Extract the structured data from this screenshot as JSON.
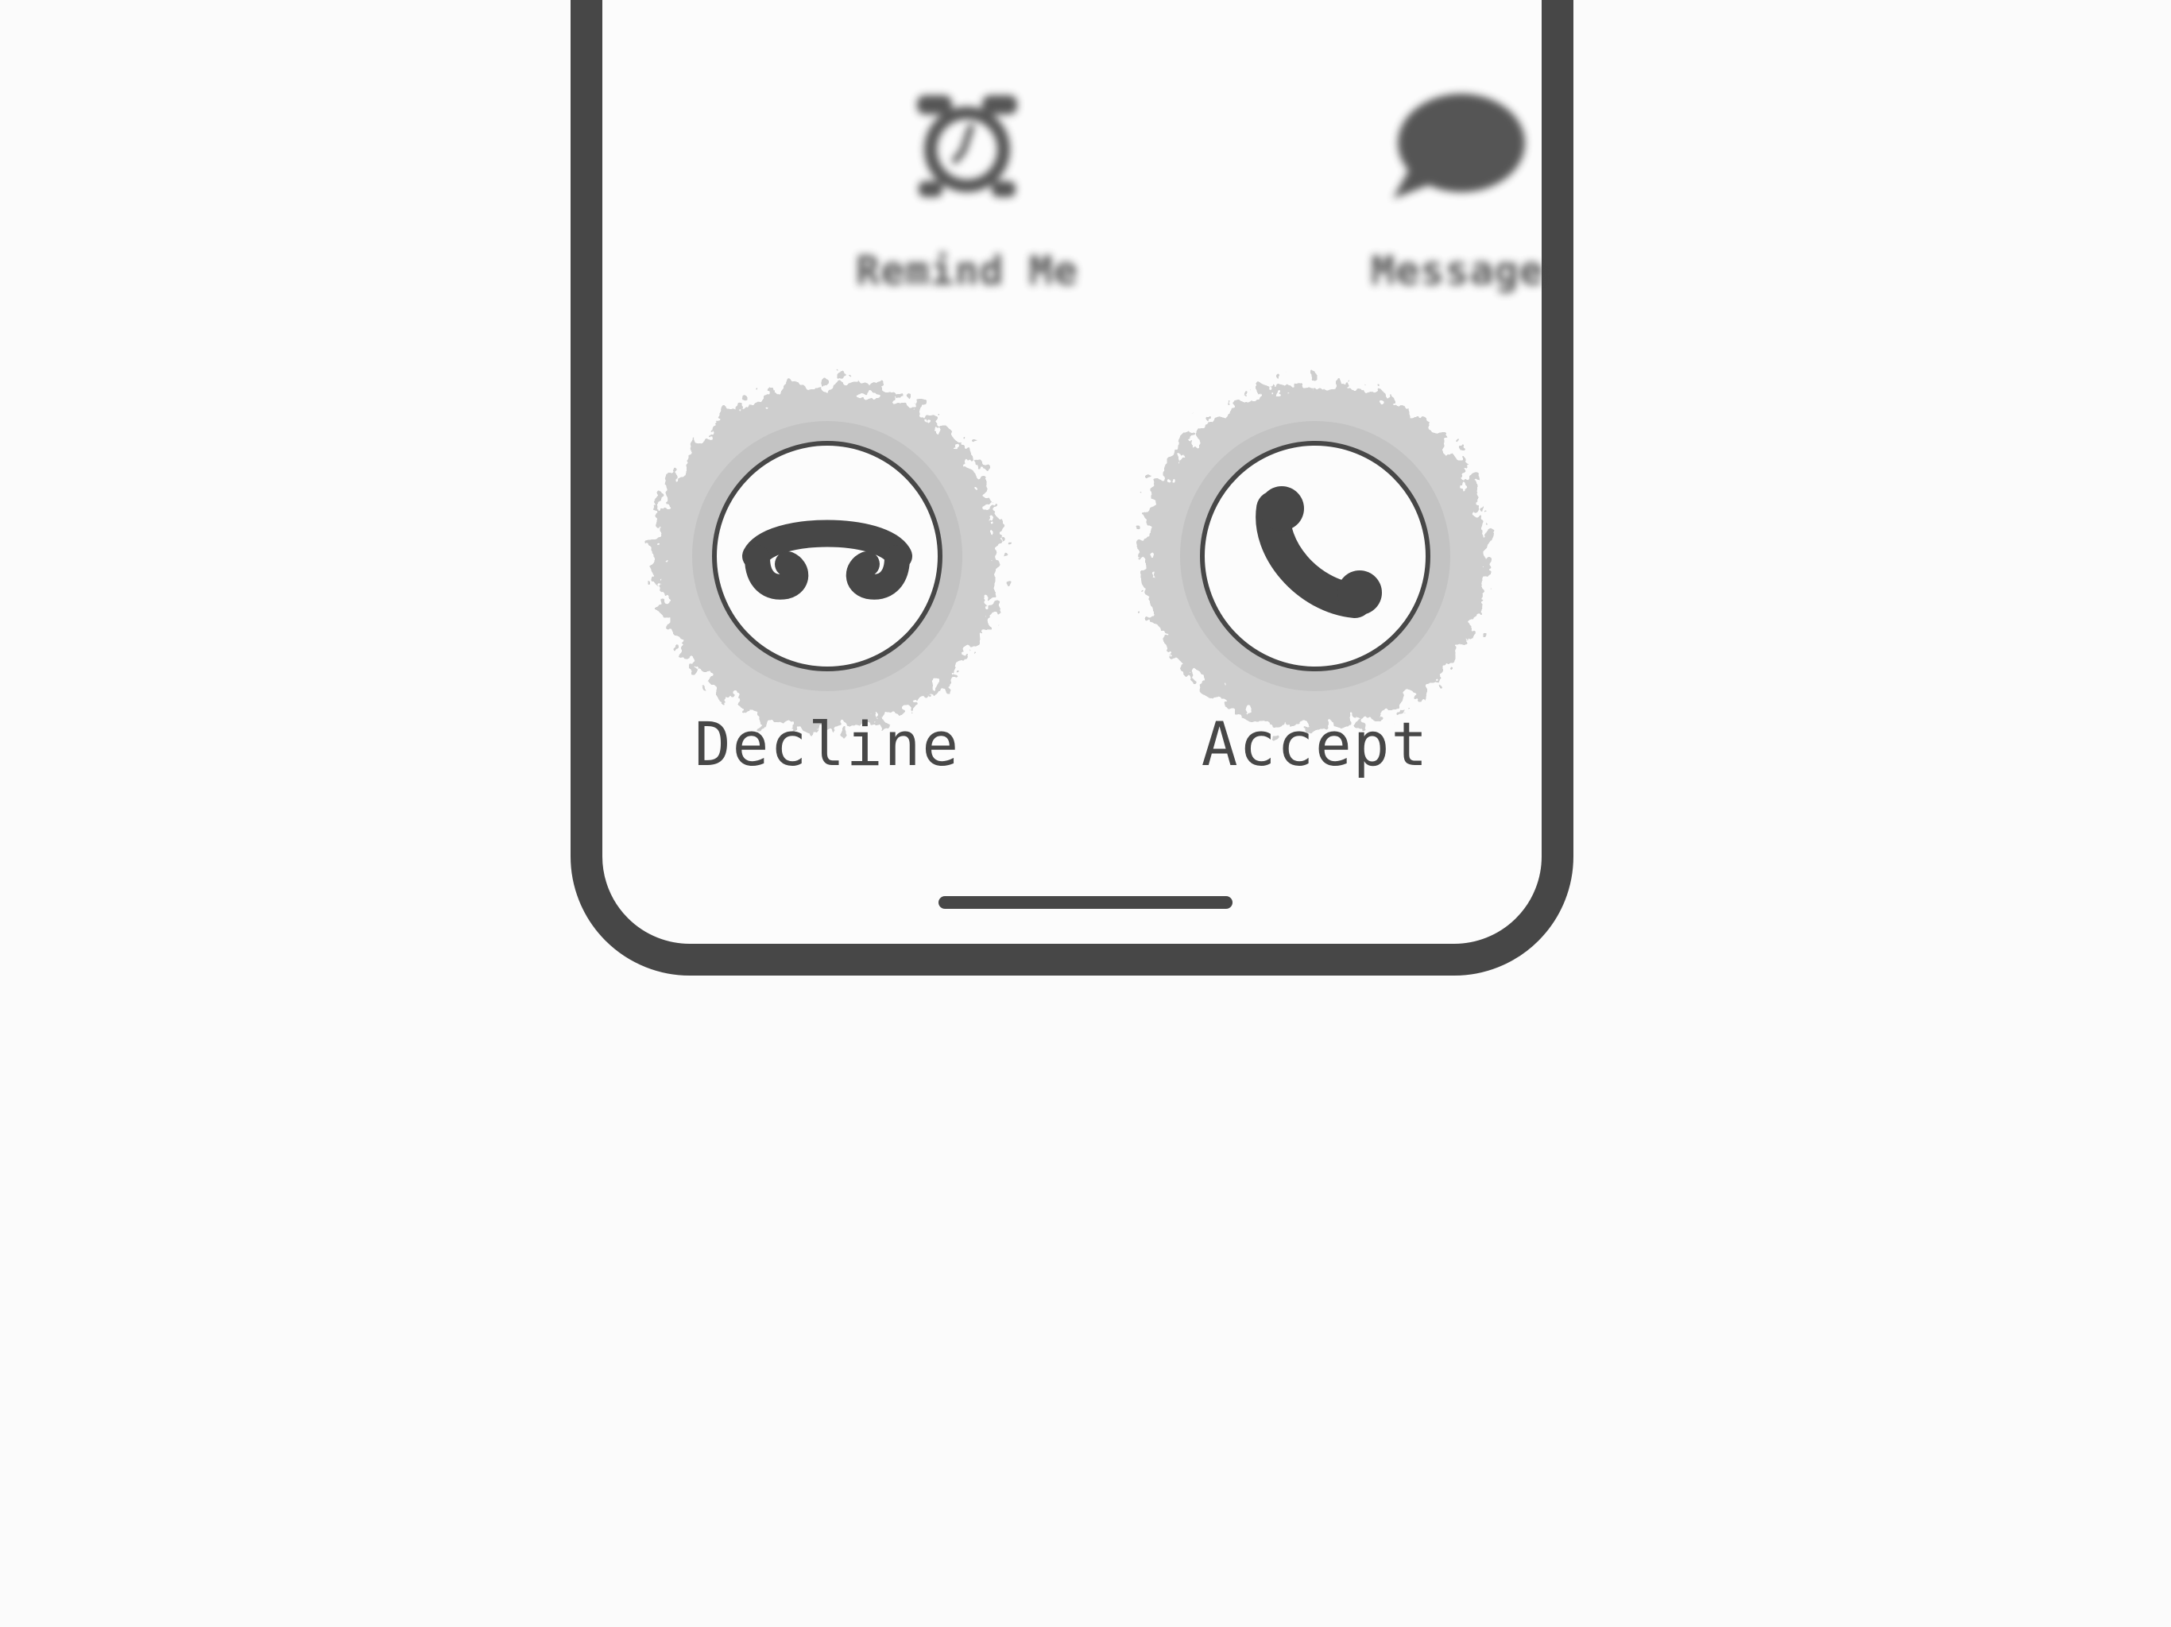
{
  "secondary_actions": {
    "remind": {
      "label": "Remind Me",
      "icon": "alarm-clock-icon"
    },
    "message": {
      "label": "Message",
      "icon": "speech-bubble-icon"
    }
  },
  "call_actions": {
    "decline": {
      "label": "Decline",
      "icon": "phone-hangup-icon"
    },
    "accept": {
      "label": "Accept",
      "icon": "phone-handset-icon"
    }
  },
  "colors": {
    "ink": "#474747",
    "halo": "#bdbdbd",
    "background": "#fbfbfb"
  }
}
